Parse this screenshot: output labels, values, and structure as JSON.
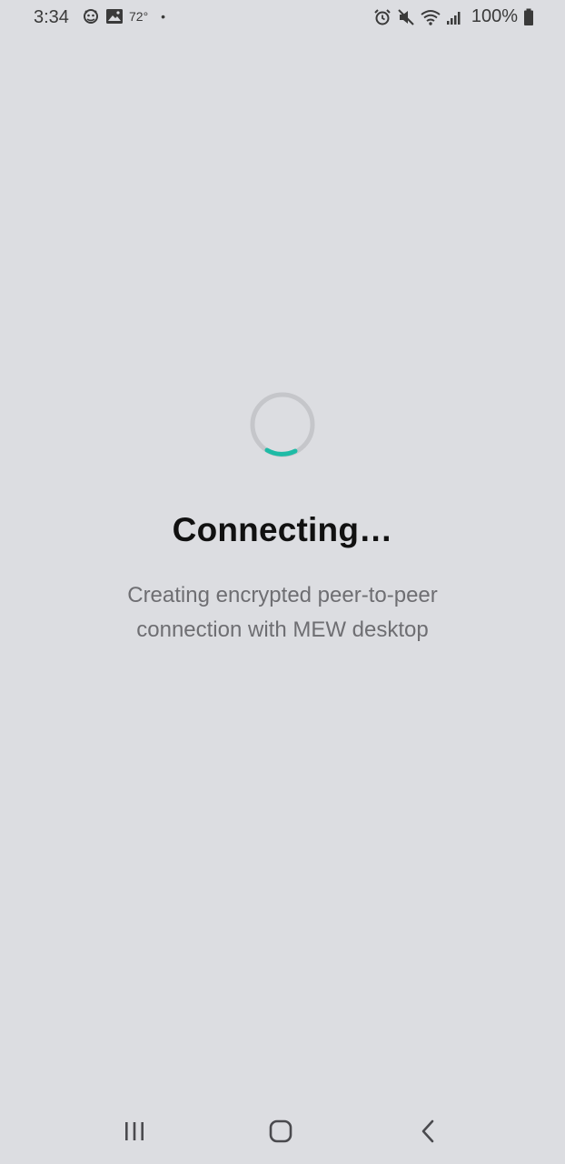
{
  "status_bar": {
    "time": "3:34",
    "temperature": "72°",
    "battery": "100%",
    "left_icons": [
      "android-head-icon",
      "image-icon"
    ],
    "right_icons": [
      "alarm-icon",
      "mute-icon",
      "wifi-icon",
      "signal-icon",
      "battery-icon"
    ]
  },
  "main": {
    "title": "Connecting…",
    "subtitle": "Creating encrypted peer-to-peer connection with MEW desktop"
  },
  "colors": {
    "background": "#DCDDE1",
    "spinner_track": "#C5C6CA",
    "spinner_accent": "#1EBBA6",
    "subtitle_text": "#6E6E72"
  },
  "nav_bar": {
    "buttons": [
      "recents-button",
      "home-button",
      "back-button"
    ]
  }
}
